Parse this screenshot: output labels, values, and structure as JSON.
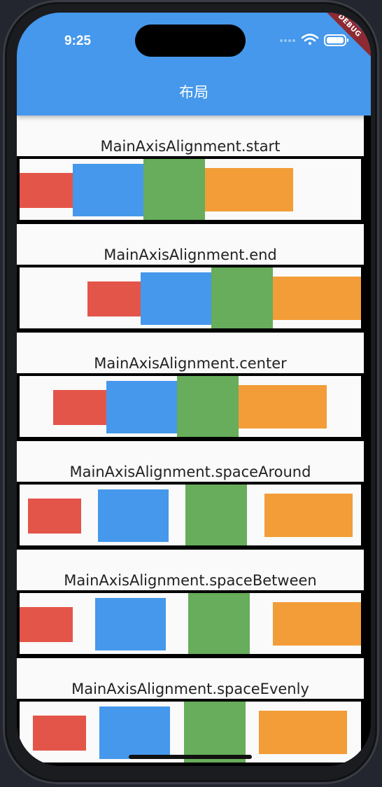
{
  "status_bar": {
    "time": "9:25",
    "debug_label": "DEBUG"
  },
  "appbar": {
    "title": "布局"
  },
  "colors": {
    "appbar": "#4598eb",
    "red": "#e45549",
    "blue": "#4598eb",
    "green": "#67ad5b",
    "orange": "#f29d38",
    "row_background": "#fafafa"
  },
  "sections": [
    {
      "caption": "MainAxisAlignment.start"
    },
    {
      "caption": "MainAxisAlignment.end"
    },
    {
      "caption": "MainAxisAlignment.center"
    },
    {
      "caption": "MainAxisAlignment.spaceAround"
    },
    {
      "caption": "MainAxisAlignment.spaceBetween"
    },
    {
      "caption": "MainAxisAlignment.spaceEvenly"
    }
  ]
}
